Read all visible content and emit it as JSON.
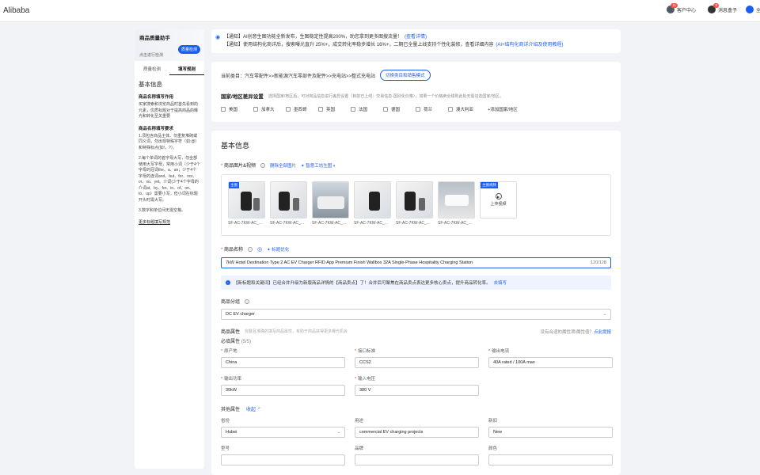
{
  "topbar": {
    "logo": "Alibaba",
    "nav": [
      {
        "icon": "customer-center-icon",
        "label": "客户中心",
        "badge": "11"
      },
      {
        "icon": "message-box-icon",
        "label": "消息盒子",
        "badge": "3"
      },
      {
        "icon": "user-icon",
        "label": "全"
      }
    ]
  },
  "left_panel": {
    "title": "商品质量助手",
    "subtitle": "点击进行检测",
    "check_button": "质量检测",
    "tabs": [
      "质量检测",
      "填写规则"
    ],
    "active_tab": 1,
    "section_title": "基本信息",
    "h1": "商品名称填写作用",
    "p1": "买家搜索和浏览商品时首先看到的元素，优质标题对于提高商品的曝光和转化至关重要",
    "h2": "商品名称填写要求",
    "p2": "1.须包含商品主体、勿重复堆砌或同义词，勿出现特殊字符（如:@）和特殊标点(如!，?）。",
    "p3": "2.每个单词的首字母大写，勿全部使用大写字母，常用小词（少于4个字母的冠词the、a、an；少于4个字母的连词and、but、for、nor、or、so、yet。介词(少于4个字母的介词at、by、for、in、of、on、to、up）需要小写，但小词在标题开头时需大写。",
    "p4": "3.数字和单位间无需空格。",
    "more_link": "更多标题填写规范"
  },
  "notice": {
    "line1": "【通知】AI创意生图功能全新发布，生图稳定性提高200%，助您拿到更多图搜流量！",
    "line1_link": "(查看详情)",
    "line2": "【通知】使用结构化商详后，搜索曝光直升 25%+，成交转化率稳步增长 16%+，二期已全量上线支持个性化装修，查看详细内容",
    "line2_link": "(AI+结构化商详介绍及使用教程)"
  },
  "category": {
    "label": "当前类目：汽车零配件>>新能源汽车零部件及配件>>充电站>>整式充电站",
    "switch_button": "切换类目和销售模式",
    "country_title": "国家/地区差异设置",
    "country_hint": "选择国家/地区后，可对商品信息进行差异设置（目前已上线：交易信息-国别化价格），如果一个价格卖全球则此处无需勾选国家/地区。",
    "countries": [
      "美国",
      "加拿大",
      "墨西哥",
      "英国",
      "法国",
      "德国",
      "荷兰",
      "澳大利亚"
    ],
    "add_country": "+添加国家/地区"
  },
  "basic": {
    "title": "基本信息",
    "images_label": "商品图片&视频",
    "delete_all": "删除全部图片",
    "ai_tool": "智意工坊生图",
    "main_tag": "主图",
    "images": [
      "SF-AC-7KW-AC_...",
      "SF-AC-7KW-AC_...",
      "SF-AC-7KW-AC_...",
      "SF-AC-7KW-AC_...",
      "SF-AC-7KW-AC_...",
      "SF-AC-7KW-AC_..."
    ],
    "video_tag": "主图视频",
    "upload_video": "上传视频",
    "name_label": "商品名称",
    "title_opt": "标题优化",
    "name_value": "7kW Hotel Destination Type 2 AC EV Charger RFID App Premium Finish Wallbox 32A Single-Phase Hospitality Charging Station",
    "name_count": "120/128",
    "tip": "【新标题和关键词】已经合并升级为新版商品详情的【商品卖点】了！合并后可聚焦在商品卖点表达更多核心卖点，提升商品转化率。",
    "tip_link": "去填写",
    "group_label": "商品分组",
    "group_value": "DC EV charger",
    "attr_label": "商品属性",
    "attr_desc": "完整且准确的填写商品属性，有助于商品获得更多曝光机会",
    "attr_right": "没有合适的属性项/属性值？",
    "attr_right_link": "点此提报",
    "required_label": "必填属性",
    "required_count": "(5/5)",
    "required": [
      {
        "label": "原产地",
        "value": "China"
      },
      {
        "label": "接口标准",
        "value": "CCS2"
      },
      {
        "label": "输出电流",
        "value": "40A rated / 100A max"
      },
      {
        "label": "输出功率",
        "value": "30kW"
      },
      {
        "label": "输入电压",
        "value": "380 V"
      }
    ],
    "other_label": "其他属性",
    "collapse": "收起",
    "other": [
      {
        "label": "省份",
        "value": "Hubei"
      },
      {
        "label": "用途",
        "value": "commercial EV charging projects"
      },
      {
        "label": "新旧",
        "value": "New"
      }
    ],
    "other2": [
      {
        "label": "型号"
      },
      {
        "label": "品牌"
      },
      {
        "label": "颜色"
      }
    ]
  }
}
